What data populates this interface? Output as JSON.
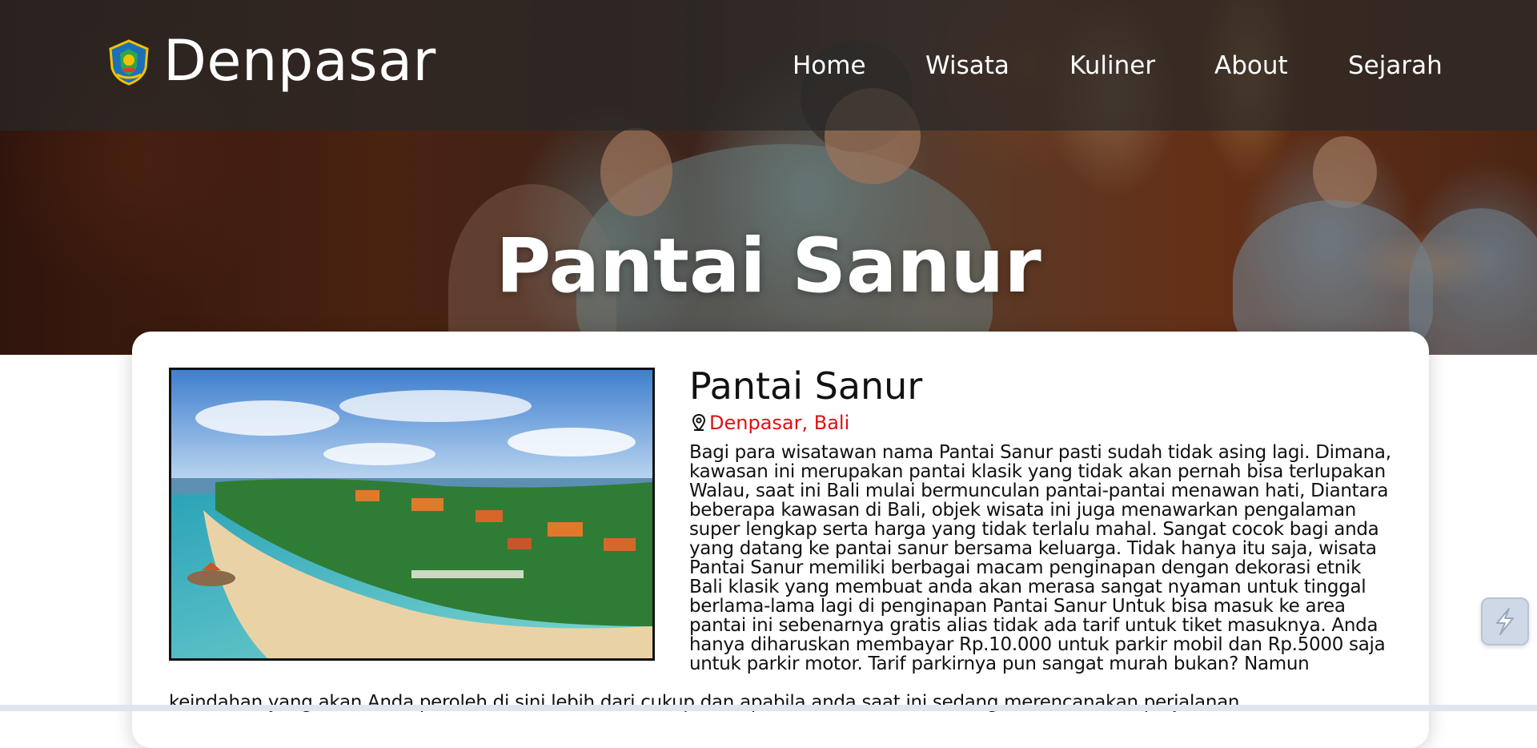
{
  "header": {
    "brand": "Denpasar",
    "logo_icon": "denpasar-emblem-icon",
    "nav": [
      {
        "label": "Home"
      },
      {
        "label": "Wisata"
      },
      {
        "label": "Kuliner"
      },
      {
        "label": "About"
      },
      {
        "label": "Sejarah"
      }
    ]
  },
  "hero": {
    "title": "Pantai Sanur"
  },
  "content": {
    "image_icon": "beach-photo",
    "title": "Pantai Sanur",
    "location_icon": "map-pin-icon",
    "location": "Denpasar, Bali",
    "location_color": "#e01010",
    "description": "Bagi para wisatawan nama Pantai Sanur pasti sudah tidak asing lagi. Dimana, kawasan ini merupakan pantai klasik yang tidak akan pernah bisa terlupakan Walau, saat ini Bali mulai bermunculan pantai-pantai menawan hati, Diantara beberapa kawasan di Bali, objek wisata ini juga menawarkan pengalaman super lengkap serta harga yang tidak terlalu mahal. Sangat cocok bagi anda yang datang ke pantai sanur bersama keluarga. Tidak hanya itu saja, wisata Pantai Sanur memiliki berbagai macam penginapan dengan dekorasi etnik Bali klasik yang membuat anda akan merasa sangat nyaman untuk tinggal berlama-lama lagi di penginapan Pantai Sanur Untuk bisa masuk ke area pantai ini sebenarnya gratis alias tidak ada tarif untuk tiket masuknya. Anda hanya diharuskan membayar Rp.10.000 untuk parkir mobil dan Rp.5000 saja untuk parkir motor. Tarif parkirnya pun sangat murah bukan? Namun",
    "description_continued": "keindahan yang akan Anda peroleh di sini lebih dari cukup dan apabila anda saat ini sedang merencanakan perjalanan"
  },
  "floating_button": {
    "icon": "lightning-extension-icon"
  }
}
